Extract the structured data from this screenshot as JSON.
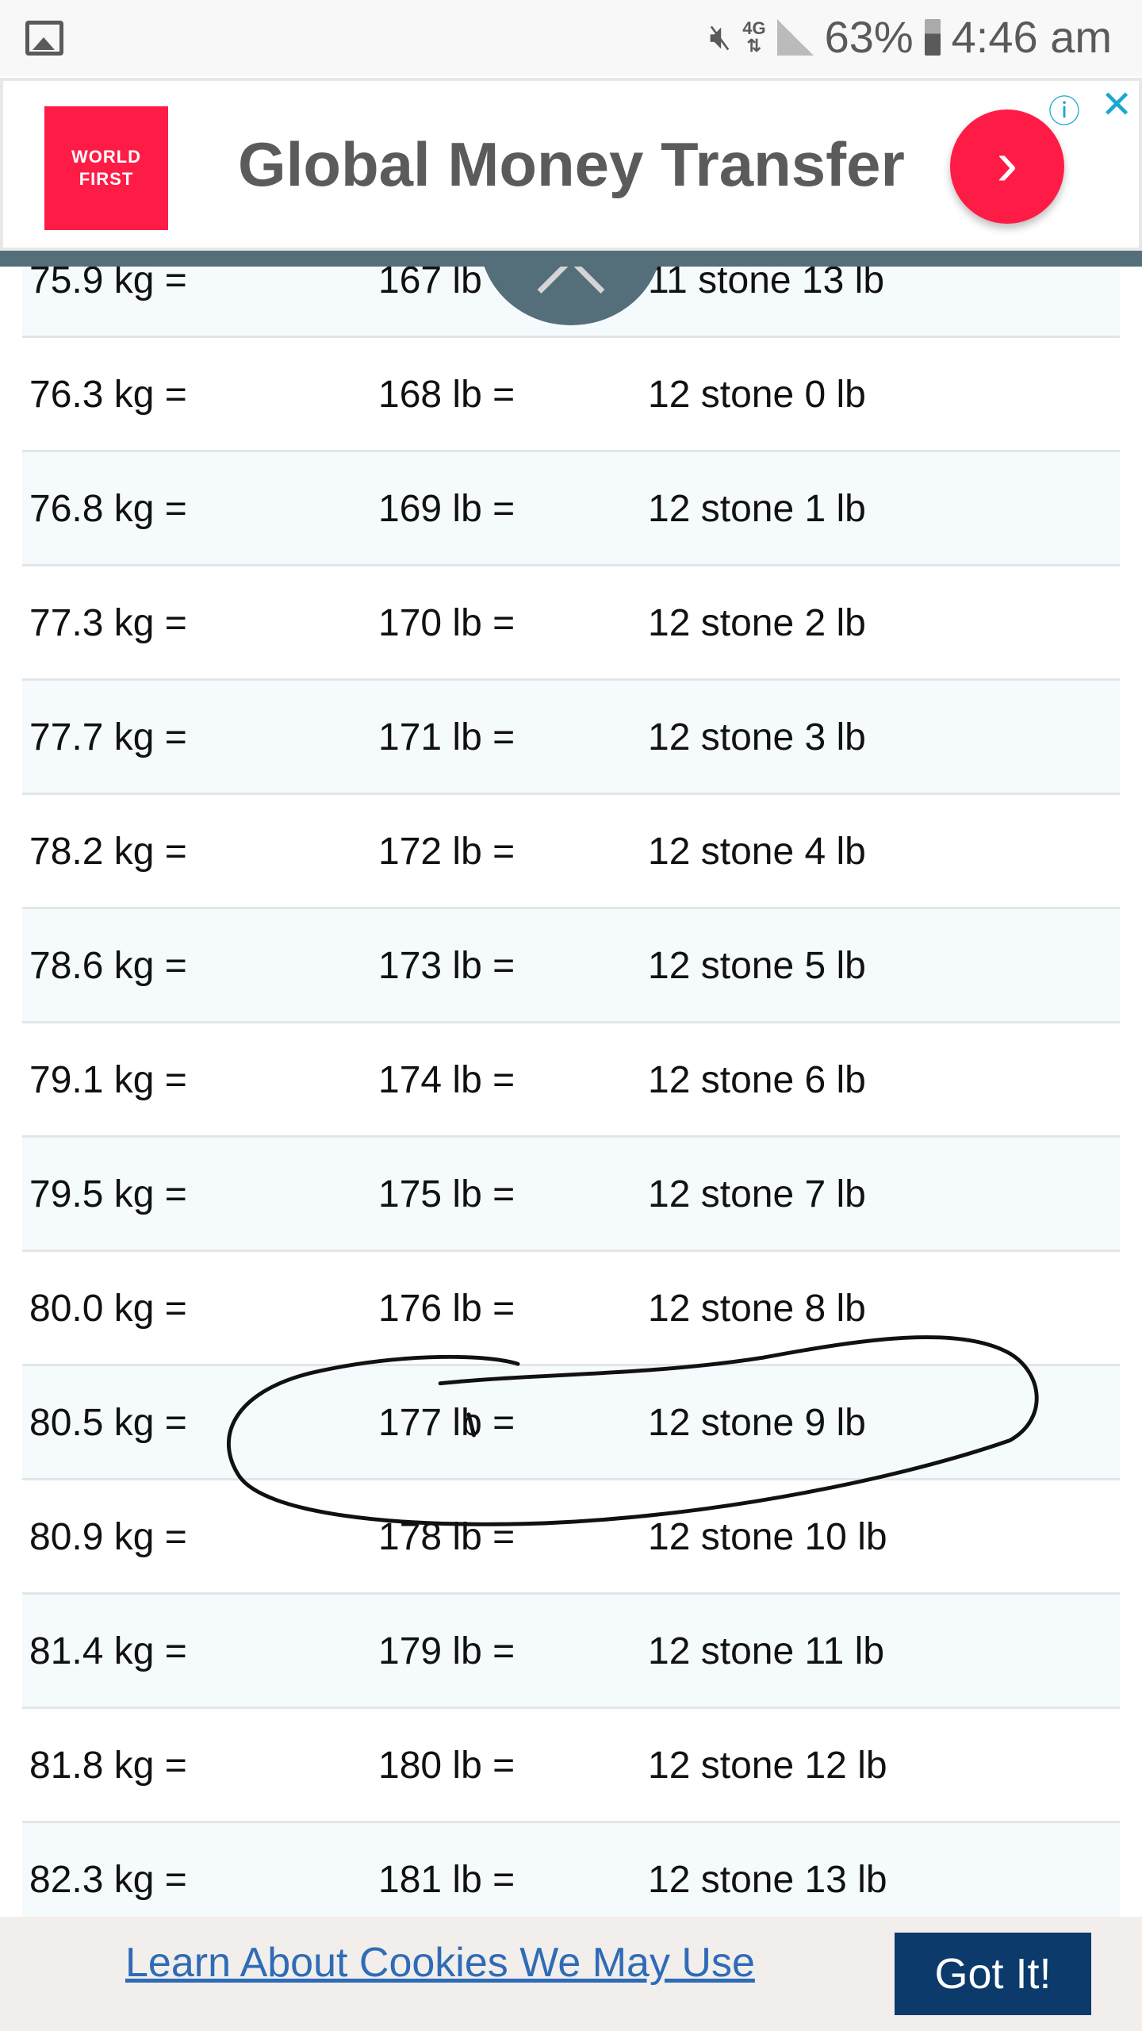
{
  "status_bar": {
    "battery": "63%",
    "time": "4:46 am",
    "network": "4G"
  },
  "ad": {
    "logo_text": "WORLD FIRST",
    "title": "Global Money Transfer",
    "cta_icon": "chevron-right-icon",
    "info_icon": "adchoices-icon",
    "close_icon": "close-icon",
    "brand_color": "#fe1c47"
  },
  "rows": [
    [
      "75.9 kg =",
      "167 lb =",
      "11 stone 13 lb"
    ],
    [
      "76.3 kg =",
      "168 lb =",
      "12 stone 0 lb"
    ],
    [
      "76.8 kg =",
      "169 lb =",
      "12 stone 1 lb"
    ],
    [
      "77.3 kg =",
      "170 lb =",
      "12 stone 2 lb"
    ],
    [
      "77.7 kg =",
      "171 lb =",
      "12 stone 3 lb"
    ],
    [
      "78.2 kg =",
      "172 lb =",
      "12 stone 4 lb"
    ],
    [
      "78.6 kg =",
      "173 lb =",
      "12 stone 5 lb"
    ],
    [
      "79.1 kg =",
      "174 lb =",
      "12 stone 6 lb"
    ],
    [
      "79.5 kg =",
      "175 lb =",
      "12 stone 7 lb"
    ],
    [
      "80.0 kg =",
      "176 lb =",
      "12 stone 8 lb"
    ],
    [
      "80.5 kg =",
      "177 lb =",
      "12 stone 9 lb"
    ],
    [
      "80.9 kg =",
      "178 lb =",
      "12 stone 10 lb"
    ],
    [
      "81.4 kg =",
      "179 lb =",
      "12 stone 11 lb"
    ],
    [
      "81.8 kg =",
      "180 lb =",
      "12 stone 12 lb"
    ],
    [
      "82.3 kg =",
      "181 lb =",
      "12 stone 13 lb"
    ]
  ],
  "cookie": {
    "link": "Learn About Cookies We May Use",
    "button": "Got It!"
  }
}
